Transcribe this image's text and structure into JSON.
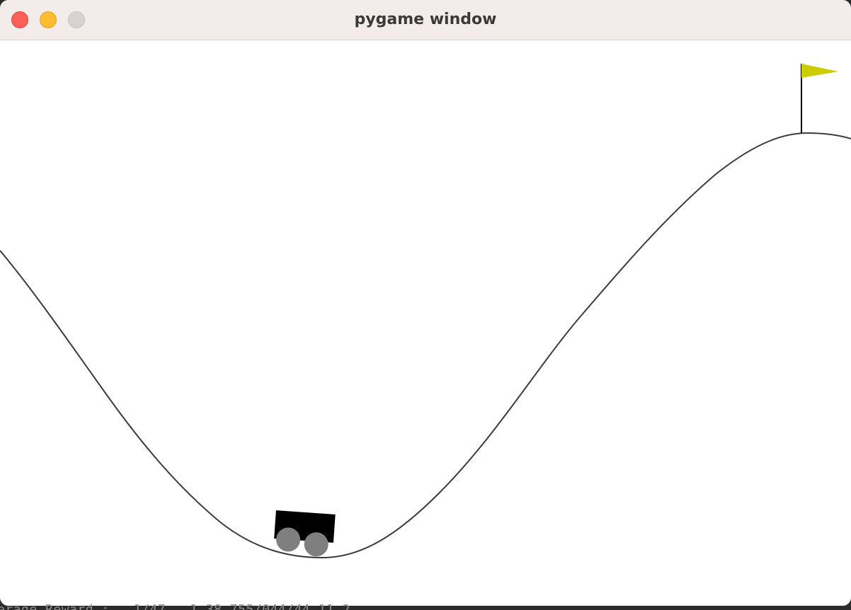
{
  "window": {
    "title": "pygame window",
    "controls": {
      "close": "close-icon",
      "minimize": "minimize-icon",
      "zoom": "zoom-icon"
    }
  },
  "scene": {
    "environment": "MountainCar",
    "colors": {
      "background": "#ffffff",
      "track": "#3c3c3c",
      "car_body": "#000000",
      "wheels": "#7f7f7f",
      "flag": "#cccc00",
      "flag_pole": "#000000"
    }
  },
  "console": {
    "text": "erage Reward :   1/47,  1.38,755/044/44,11.2"
  }
}
